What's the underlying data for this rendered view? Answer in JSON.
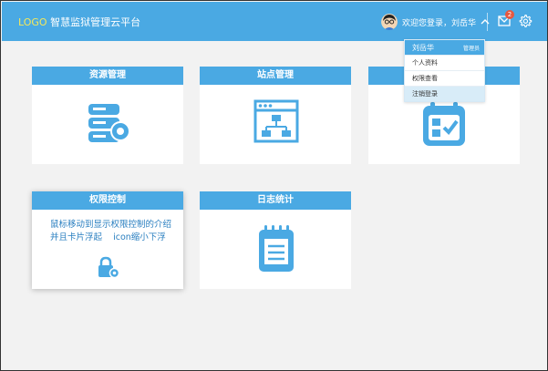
{
  "header": {
    "logo_text": "LOGO",
    "title": "智慧监狱管理云平台",
    "welcome": "欢迎您登录，刘岳华",
    "mail_badge": "2"
  },
  "cards": [
    {
      "title": "资源管理",
      "icon": "server-gear-icon"
    },
    {
      "title": "站点管理",
      "icon": "sitemap-window-icon"
    },
    {
      "title": "",
      "icon": "calendar-check-icon"
    },
    {
      "title": "权限控制",
      "icon": "lock-gear-icon",
      "intro": "鼠标移动到显示权限控制的介绍\n并且卡片浮起    icon缩小下浮"
    },
    {
      "title": "日志统计",
      "icon": "notepad-icon"
    }
  ],
  "user_menu": {
    "name": "刘岳华",
    "role": "管理员",
    "items": [
      "个人资料",
      "权限查看",
      "注销登录"
    ]
  },
  "colors": {
    "primary": "#4aa9e3",
    "logo": "#f5e85a",
    "badge": "#e8583f",
    "background": "#f2f2f2"
  }
}
